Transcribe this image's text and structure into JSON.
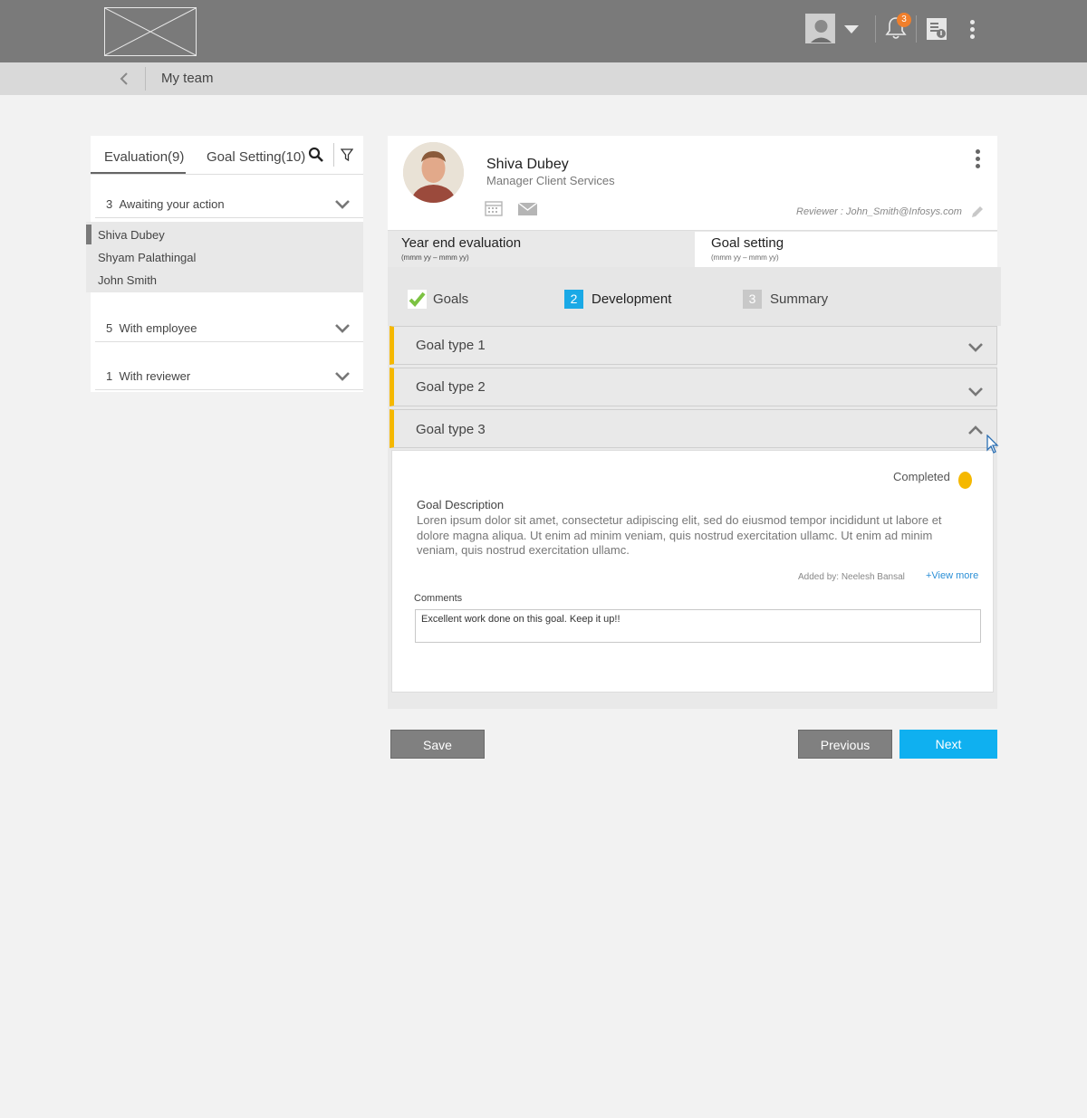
{
  "header": {
    "notification_count": "3"
  },
  "breadcrumb": {
    "title": "My team"
  },
  "left_panel": {
    "tabs": [
      {
        "label": "Evaluation(9)",
        "active": true
      },
      {
        "label": "Goal Setting(10)",
        "active": false
      }
    ],
    "groups": [
      {
        "count": "3",
        "label": "Awaiting your action",
        "expanded": true
      },
      {
        "count": "5",
        "label": "With employee",
        "expanded": false
      },
      {
        "count": "1",
        "label": "With reviewer",
        "expanded": false
      }
    ],
    "people": [
      "Shiva Dubey",
      "Shyam Palathingal",
      "John Smith"
    ],
    "selected_person": "Shiva Dubey"
  },
  "profile": {
    "name": "Shiva Dubey",
    "role": "Manager Client Services",
    "reviewer": "Reviewer : John_Smith@Infosys.com"
  },
  "main_tabs": [
    {
      "title": "Year end evaluation",
      "subtitle": "(mmm yy – mmm yy)",
      "active": true
    },
    {
      "title": "Goal setting",
      "subtitle": "(mmm yy – mmm yy)",
      "active": false
    }
  ],
  "steps": [
    {
      "number": "",
      "label": "Goals",
      "state": "done",
      "color": "#7cc242"
    },
    {
      "number": "2",
      "label": "Development",
      "state": "active",
      "color": "#1aa9e6"
    },
    {
      "number": "3",
      "label": "Summary",
      "state": "pending",
      "color": "#c8c8c8"
    }
  ],
  "goals": [
    {
      "label": "Goal type 1",
      "expanded": false
    },
    {
      "label": "Goal type 2",
      "expanded": false
    },
    {
      "label": "Goal type 3",
      "expanded": true
    }
  ],
  "goal_detail": {
    "status": "Completed",
    "status_color": "#f5b800",
    "description_title": "Goal Description",
    "description": "Loren ipsum dolor sit amet, consectetur adipiscing elit, sed do eiusmod tempor incididunt ut labore et dolore magna aliqua. Ut enim ad minim veniam, quis nostrud exercitation ullamc. Ut enim ad minim veniam, quis nostrud exercitation ullamc.",
    "added_by": "Added by: Neelesh Bansal",
    "view_more": "+View more",
    "comments_label": "Comments",
    "comment": "Excellent work done on this goal. Keep it up!!"
  },
  "actions": {
    "save": "Save",
    "previous": "Previous",
    "next": "Next"
  },
  "colors": {
    "accent": "#0fb0f0",
    "goal_marker": "#f5b800",
    "badge": "#f07f2b"
  }
}
